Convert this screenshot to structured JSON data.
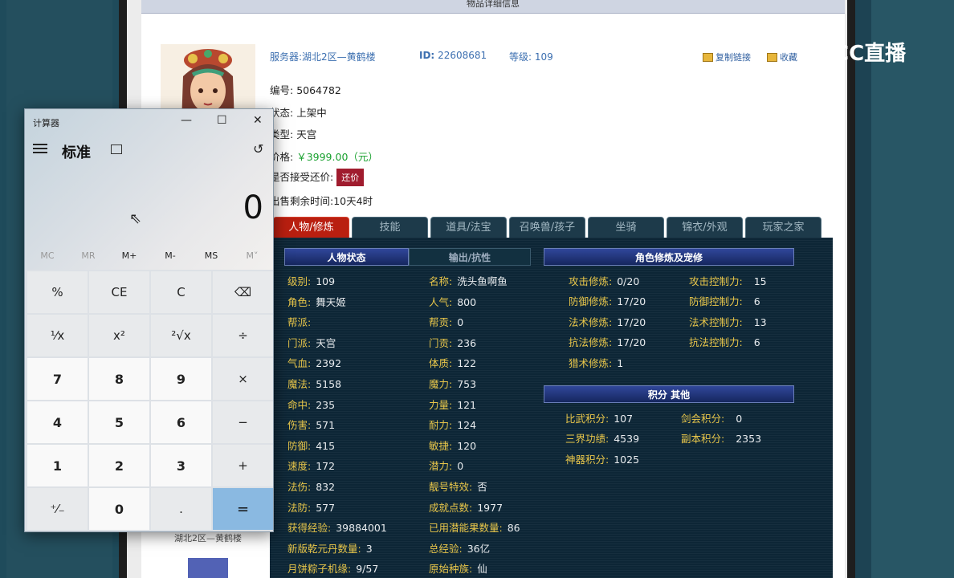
{
  "page": {
    "top_title": "物品详细信息",
    "server_label": "服务器:",
    "server": "湖北2区—黄鹤楼",
    "id_label": "ID:",
    "id": "22608681",
    "level_label": "等级:",
    "level": "109",
    "copy_link": "复制链接",
    "favorite": "收藏",
    "rows": [
      {
        "label": "编号:",
        "value": "5064782"
      },
      {
        "label": "状态:",
        "value": "上架中"
      },
      {
        "label": "类型:",
        "value": "天宫"
      },
      {
        "label": "价格:",
        "value": "￥3999.00（元）"
      },
      {
        "label": "是否接受还价:",
        "value": "还价"
      },
      {
        "label": "出售剩余时间:",
        "value": "10天4时"
      }
    ],
    "bottom_server": "湖北2区—黄鹤楼"
  },
  "tabs": [
    "人物/修炼",
    "技能",
    "道具/法宝",
    "召唤兽/孩子",
    "坐骑",
    "锦衣/外观",
    "玩家之家"
  ],
  "headers": {
    "char_state": "人物状态",
    "output": "输出/抗性",
    "cultivation": "角色修炼及宠修",
    "points": "积分 其他"
  },
  "stats_left": [
    {
      "k": "级别:",
      "v": "109"
    },
    {
      "k": "角色:",
      "v": "舞天姬"
    },
    {
      "k": "帮派:",
      "v": ""
    },
    {
      "k": "门派:",
      "v": "天宫"
    },
    {
      "k": "气血:",
      "v": "2392"
    },
    {
      "k": "魔法:",
      "v": "5158"
    },
    {
      "k": "命中:",
      "v": "235"
    },
    {
      "k": "伤害:",
      "v": "571"
    },
    {
      "k": "防御:",
      "v": "415"
    },
    {
      "k": "速度:",
      "v": "172"
    },
    {
      "k": "法伤:",
      "v": "832"
    },
    {
      "k": "法防:",
      "v": "577"
    },
    {
      "k": "获得经验:",
      "v": "39884001"
    },
    {
      "k": "新版乾元丹数量:",
      "v": "3"
    },
    {
      "k": "月饼粽子机缘:",
      "v": "9/57"
    }
  ],
  "stats_mid": [
    {
      "k": "名称:",
      "v": "洗头鱼啊鱼"
    },
    {
      "k": "人气:",
      "v": "800"
    },
    {
      "k": "帮贡:",
      "v": "0"
    },
    {
      "k": "门贡:",
      "v": "236"
    },
    {
      "k": "体质:",
      "v": "122"
    },
    {
      "k": "魔力:",
      "v": "753"
    },
    {
      "k": "力量:",
      "v": "121"
    },
    {
      "k": "耐力:",
      "v": "124"
    },
    {
      "k": "敏捷:",
      "v": "120"
    },
    {
      "k": "潜力:",
      "v": "0"
    },
    {
      "k": "靓号特效:",
      "v": "否"
    },
    {
      "k": "成就点数:",
      "v": "1977"
    },
    {
      "k": "已用潜能果数量:",
      "v": "86"
    },
    {
      "k": "总经验:",
      "v": "36亿"
    },
    {
      "k": "原始种族:",
      "v": "仙"
    }
  ],
  "cultivation": [
    {
      "k": "攻击修炼:",
      "v": "0/20",
      "k2": "攻击控制力:",
      "v2": "15"
    },
    {
      "k": "防御修炼:",
      "v": "17/20",
      "k2": "防御控制力:",
      "v2": "6"
    },
    {
      "k": "法术修炼:",
      "v": "17/20",
      "k2": "法术控制力:",
      "v2": "13"
    },
    {
      "k": "抗法修炼:",
      "v": "17/20",
      "k2": "抗法控制力:",
      "v2": "6"
    },
    {
      "k": "猎术修炼:",
      "v": "1",
      "k2": "",
      "v2": ""
    }
  ],
  "points": [
    {
      "k": "比武积分:",
      "v": "107",
      "k2": "剑会积分:",
      "v2": "0"
    },
    {
      "k": "三界功绩:",
      "v": "4539",
      "k2": "副本积分:",
      "v2": "2353"
    },
    {
      "k": "神器积分:",
      "v": "1025",
      "k2": "",
      "v2": ""
    }
  ],
  "calculator": {
    "title": "计算器",
    "mode": "标准",
    "display": "0",
    "memory": [
      "MC",
      "MR",
      "M+",
      "M-",
      "MS",
      "M˅"
    ],
    "keys": [
      "%",
      "CE",
      "C",
      "⌫",
      "¹⁄x",
      "x²",
      "²√x",
      "÷",
      "7",
      "8",
      "9",
      "×",
      "4",
      "5",
      "6",
      "−",
      "1",
      "2",
      "3",
      "+",
      "⁺⁄₋",
      "0",
      ".",
      "="
    ]
  },
  "watermark": "CC直播"
}
